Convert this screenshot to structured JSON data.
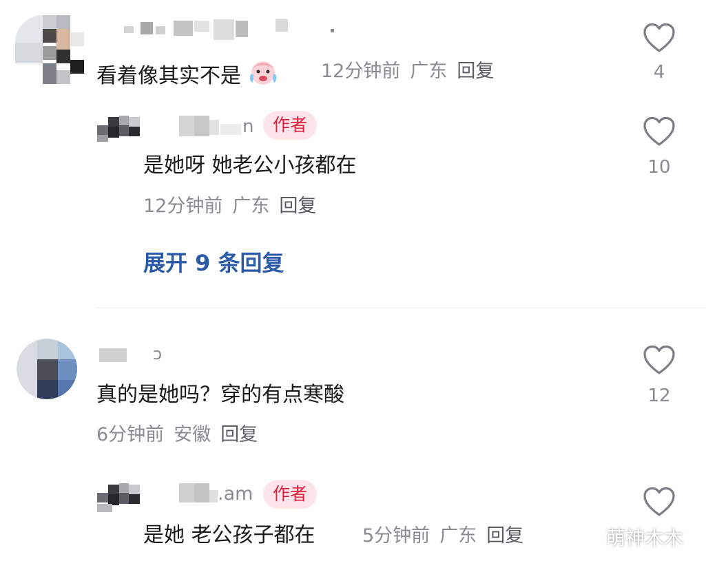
{
  "comments": [
    {
      "text": "看着像其实不是",
      "emoji": "crying-face-emoji",
      "time": "12分钟前",
      "location": "广东",
      "reply_label": "回复",
      "likes": "4",
      "replies": [
        {
          "username_visible": "n",
          "author_tag": "作者",
          "text": "是她呀 她老公小孩都在",
          "time": "12分钟前",
          "location": "广东",
          "reply_label": "回复",
          "likes": "10"
        }
      ],
      "expand_label": "展开 9 条回复"
    },
    {
      "username_visible": "ɔ",
      "text": "真的是她吗？穿的有点寒酸",
      "time": "6分钟前",
      "location": "安徽",
      "reply_label": "回复",
      "likes": "12",
      "replies": [
        {
          "username_visible": ".am",
          "author_tag": "作者",
          "text": "是她 老公孩子都在",
          "time": "5分钟前",
          "location": "广东",
          "reply_label": "回复",
          "likes": ""
        }
      ]
    }
  ],
  "watermark": "萌神木木",
  "colors": {
    "author_tag_bg": "#fde4e8",
    "author_tag_text": "#e8203f",
    "expand_link": "#2b5aa8",
    "meta_text": "#8a8b91"
  },
  "icons": {
    "like": "heart-outline-icon"
  }
}
